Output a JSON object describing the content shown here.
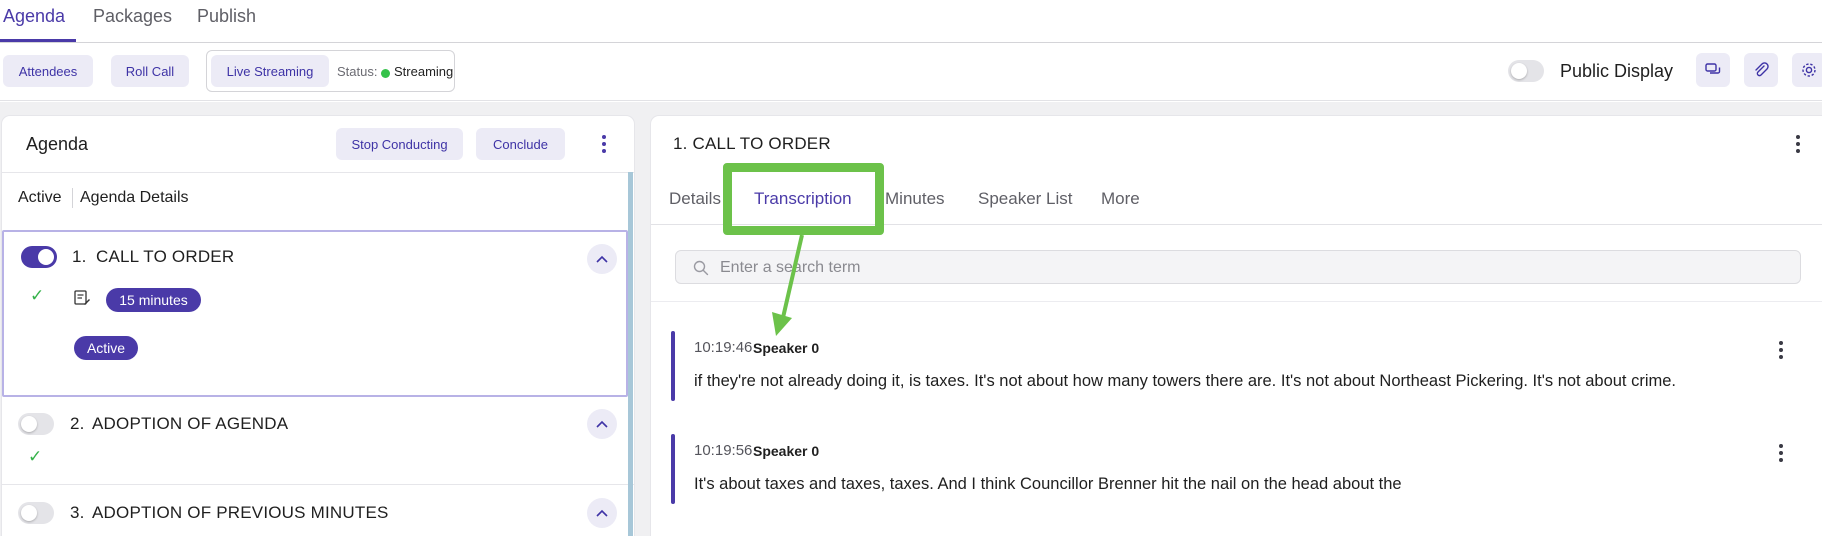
{
  "top_tabs": [
    "Agenda",
    "Packages",
    "Publish"
  ],
  "toolbar": {
    "attendees_label": "Attendees",
    "roll_call_label": "Roll Call",
    "live_streaming_label": "Live Streaming",
    "status_label": "Status:",
    "status_value": "Streaming",
    "status_color": "#35c24a",
    "public_display_label": "Public Display",
    "public_display_on": false
  },
  "agenda_panel": {
    "title": "Agenda",
    "stop_conducting_label": "Stop Conducting",
    "conclude_label": "Conclude",
    "subtabs": [
      "Active",
      "Agenda Details"
    ],
    "items": [
      {
        "number": "1.",
        "title": "CALL TO ORDER",
        "enabled": true,
        "duration": "15 minutes",
        "status": "Active"
      },
      {
        "number": "2.",
        "title": "ADOPTION OF AGENDA",
        "enabled": false
      },
      {
        "number": "3.",
        "title": "ADOPTION OF PREVIOUS MINUTES",
        "enabled": false
      }
    ]
  },
  "detail_panel": {
    "title": "1. CALL TO ORDER",
    "tabs": [
      "Details",
      "Transcription",
      "Minutes",
      "Speaker List",
      "More"
    ],
    "active_tab": "Transcription",
    "search_placeholder": "Enter a search term",
    "entries": [
      {
        "time": "10:19:46",
        "speaker": "Speaker 0",
        "text": "if they're not already doing it, is taxes. It's not about how many towers there are. It's not about Northeast Pickering. It's not about crime."
      },
      {
        "time": "10:19:56",
        "speaker": "Speaker 0",
        "text": "It's about taxes and taxes, taxes. And I think Councillor Brenner hit the nail on the head about the"
      }
    ]
  },
  "colors": {
    "accent": "#4a3aa8",
    "accent_light": "#ecebf6",
    "check_green": "#35b24a",
    "annotation_green": "#6cc24a"
  }
}
